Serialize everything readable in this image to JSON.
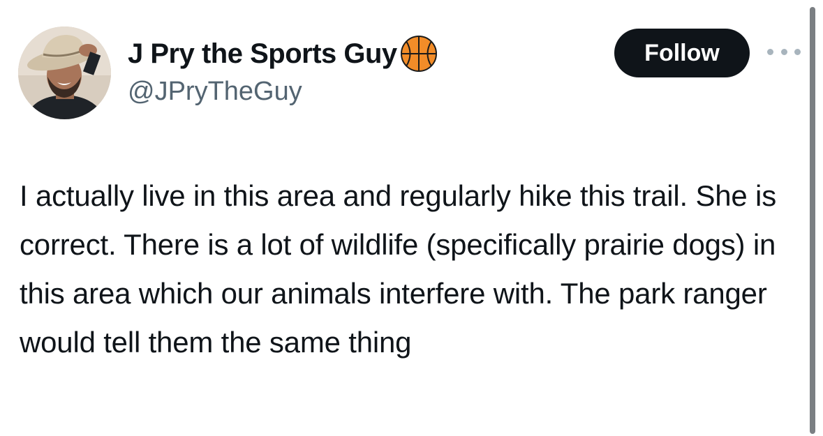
{
  "author": {
    "display_name": "J Pry the Sports Guy",
    "handle": "@JPryTheGuy",
    "badge_icon": "basketball-icon",
    "avatar_icon": "avatar-photo"
  },
  "actions": {
    "follow_label": "Follow",
    "more_icon": "more-options-icon"
  },
  "tweet": {
    "text": "I actually live in this area and regularly hike this trail. She is correct. There is a lot of wildlife (specifically prairie dogs) in this area which our animals interfere with. The park ranger would tell them the same thing"
  },
  "colors": {
    "text_primary": "#0f1419",
    "text_secondary": "#536471",
    "follow_bg": "#0f1419",
    "follow_text": "#ffffff",
    "basketball": "#f28c28"
  }
}
